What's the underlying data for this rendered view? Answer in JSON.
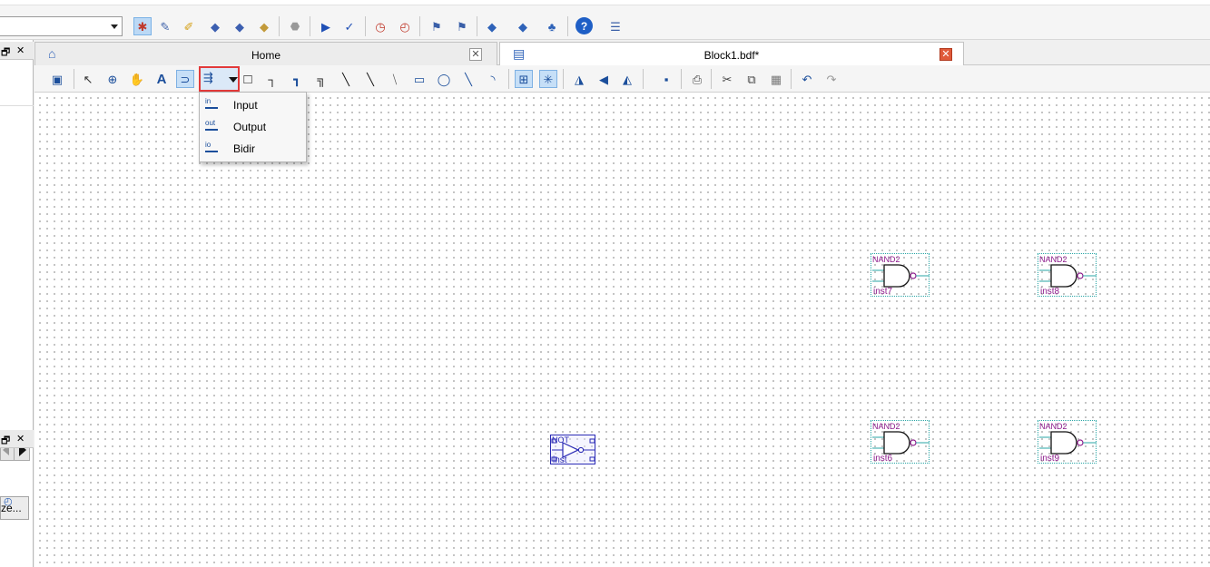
{
  "toolbar": {
    "icons": [
      "compile-icon",
      "pencil-icon",
      "wand-icon",
      "analysis-icon",
      "synthesis-icon",
      "fitter-icon",
      "stop-icon",
      "play-icon",
      "assembler-icon",
      "timer-icon",
      "stopwatch-icon",
      "netlist-icon",
      "netlist2-icon",
      "download-icon",
      "programmer-icon",
      "hierarchy-icon",
      "help-icon",
      "chat-icon"
    ]
  },
  "left_panel": {
    "button_label": "ze..."
  },
  "tabs": [
    {
      "label": "Home"
    },
    {
      "label": "Block1.bdf*"
    }
  ],
  "editor_toolbar": {
    "pin_menu_items": [
      {
        "icon_text": "in",
        "label": "Input"
      },
      {
        "icon_text": "out",
        "label": "Output"
      },
      {
        "icon_text": "io",
        "label": "Bidir"
      }
    ]
  },
  "symbols": [
    {
      "type": "NAND2",
      "instance": "inst7"
    },
    {
      "type": "NAND2",
      "instance": "inst8"
    },
    {
      "type": "NOT",
      "instance": "inst"
    },
    {
      "type": "NAND2",
      "instance": "inst6"
    },
    {
      "type": "NAND2",
      "instance": "inst9"
    }
  ],
  "colors": {
    "highlight_border": "#e23a3a",
    "symbol_text": "#8c1a8c",
    "tab_close_active": "#e05a3a"
  }
}
